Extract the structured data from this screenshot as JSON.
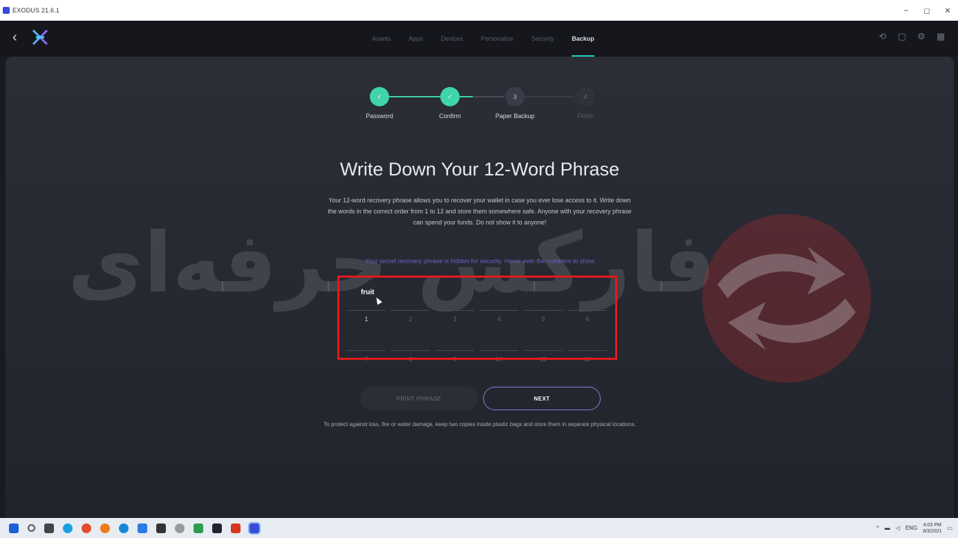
{
  "window": {
    "title": "EXODUS 21.6.1",
    "controls": [
      "–",
      "◻",
      "✕"
    ]
  },
  "nav": {
    "back_label": "‹",
    "tabs": [
      {
        "label": "Assets"
      },
      {
        "label": "Apps"
      },
      {
        "label": "Devices"
      },
      {
        "label": "Personalize"
      },
      {
        "label": "Security"
      },
      {
        "label": "Backup",
        "active": true
      }
    ],
    "right_icons": [
      "history-icon",
      "lock-icon",
      "gear-icon",
      "grid-icon"
    ]
  },
  "stepper": {
    "steps": [
      {
        "label": "Password",
        "state": "done",
        "marker": "✓"
      },
      {
        "label": "Confirm",
        "state": "done",
        "marker": "✓"
      },
      {
        "label": "Paper Backup",
        "state": "current",
        "marker": "3"
      },
      {
        "label": "Finish",
        "state": "future",
        "marker": "4"
      }
    ]
  },
  "main": {
    "heading": "Write Down Your 12-Word Phrase",
    "description": "Your 12-word recovery phrase allows you to recover your wallet in case you ever lose access to it. Write down the words in the correct order from 1 to 12 and store them somewhere safe. Anyone with your recovery phrase can spend your funds. Do not show it to anyone!",
    "hint": "Your secret recovery phrase is hidden for security. Hover over the numbers to show",
    "words": [
      {
        "num": "1",
        "word": "fruit",
        "active": true
      },
      {
        "num": "2",
        "word": ""
      },
      {
        "num": "3",
        "word": ""
      },
      {
        "num": "4",
        "word": ""
      },
      {
        "num": "5",
        "word": ""
      },
      {
        "num": "6",
        "word": ""
      },
      {
        "num": "7",
        "word": ""
      },
      {
        "num": "8",
        "word": ""
      },
      {
        "num": "9",
        "word": ""
      },
      {
        "num": "10",
        "word": ""
      },
      {
        "num": "11",
        "word": ""
      },
      {
        "num": "12",
        "word": ""
      }
    ],
    "print_button": "PRINT PHRASE",
    "next_button": "NEXT",
    "footer_note": "To protect against loss, fire or water damage, keep two copies inside plastic bags and store them in separate physical locations."
  },
  "watermark": {
    "text": "فارکس حرفه‌ای"
  },
  "taskbar": {
    "tray_lang": "ENG",
    "time": "4:03 PM",
    "date": "8/3/2021"
  },
  "colors": {
    "accent_teal": "#3fd5a8",
    "tab_underline": "#1fd3bf",
    "next_border": "#7a86d8",
    "highlight": "#e31b1b"
  }
}
